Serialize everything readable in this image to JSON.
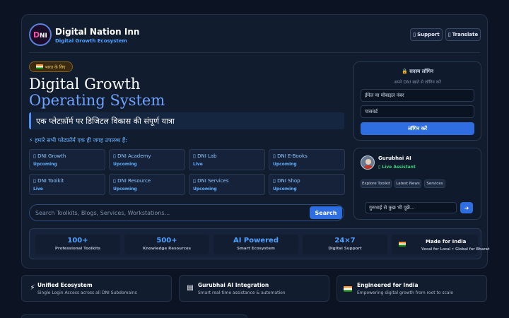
{
  "header": {
    "brand_title": "Digital Nation Inn",
    "brand_subtitle": "Digital Growth Ecosystem",
    "support_label": "Support",
    "translate_label": "Translate"
  },
  "hero": {
    "badge": "भारत के लिए",
    "title_line1": "Digital Growth",
    "title_line2": "Operating System",
    "tagline": "एक प्लेटफ़ॉर्म पर डिजिटल विकास की संपूर्ण यात्रा",
    "features_heading": "⚡ हमारे सभी प्लेटफ़ॉर्म एक ही जगह उपलब्ध हैं:"
  },
  "modules": [
    {
      "title": "DNI Growth",
      "status": "Upcoming"
    },
    {
      "title": "DNI Academy",
      "status": "Upcoming"
    },
    {
      "title": "DNI Lab",
      "status": "Live"
    },
    {
      "title": "DNI E-Books",
      "status": "Upcoming"
    },
    {
      "title": "DNI Toolkit",
      "status": "Live"
    },
    {
      "title": "DNI Resource",
      "status": "Upcoming"
    },
    {
      "title": "DNI Services",
      "status": "Upcoming"
    },
    {
      "title": "DNI Shop",
      "status": "Upcoming"
    }
  ],
  "search": {
    "placeholder": "Search Toolkits, Blogs, Services, Workstations...",
    "button": "Search"
  },
  "login": {
    "title": "🔒 सदस्य लॉगिन",
    "subtitle": "अपने DNI खाते से लॉगिन करें",
    "email_placeholder": "ईमेल या मोबाइल नंबर",
    "password_placeholder": "पासवर्ड",
    "button": "लॉगिन करें"
  },
  "assistant": {
    "name": "Gurubhai AI",
    "status": "Live Assistant",
    "chips": [
      "Explore Toolkit",
      "Latest News",
      "Services"
    ],
    "input_placeholder": "गुरुभाई से कुछ भी पूछें...",
    "send": "➜"
  },
  "stats": [
    {
      "value": "100+",
      "label": "Professional Toolkits"
    },
    {
      "value": "500+",
      "label": "Knowledge Resources"
    },
    {
      "value": "AI Powered",
      "label": "Smart Ecosystem"
    },
    {
      "value": "24×7",
      "label": "Digital Support"
    }
  ],
  "india_stat": {
    "title": "Made for India",
    "subtitle": "Vocal for Local • Global for Bharat"
  },
  "bottom_features": [
    {
      "icon": "⚡",
      "icon_name": "lightning-icon",
      "title": "Unified Ecosystem",
      "subtitle": "Single Login Access across all DNI Subdomains"
    },
    {
      "icon": "▤",
      "icon_name": "server-icon",
      "title": "Gurubhai AI Integration",
      "subtitle": "Smart real-time assistance & automation"
    },
    {
      "icon": "",
      "icon_name": "india-flag-icon",
      "title": "Engineered for India",
      "subtitle": "Empowering digital growth from root to scale"
    }
  ],
  "colors": {
    "background": "#0c1424",
    "card": "#111c2e",
    "accent": "#2f6ee0",
    "accent_text": "#4fa3ff",
    "live_green": "#3fd07a"
  }
}
